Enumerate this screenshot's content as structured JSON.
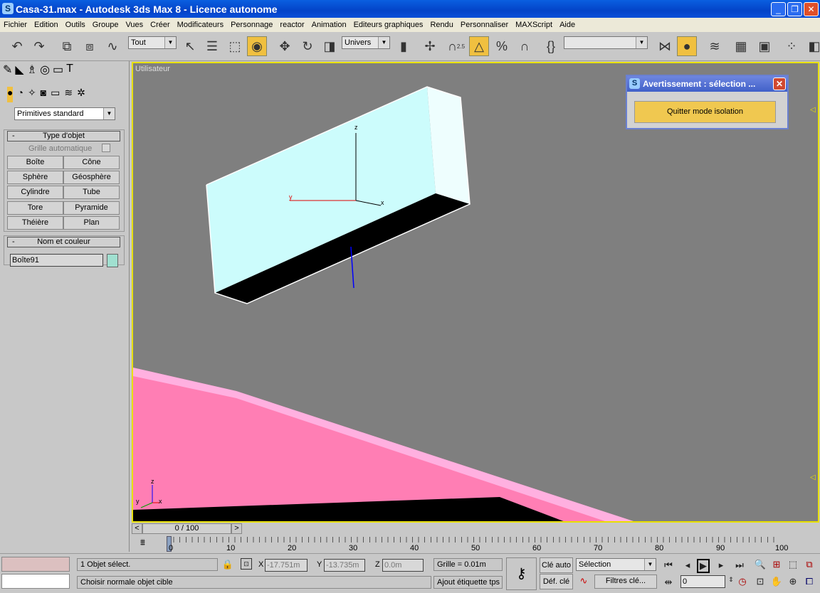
{
  "window": {
    "title": "Casa-31.max - Autodesk 3ds Max 8  - Licence autonome",
    "minimize": "_",
    "maximize": "❐",
    "close": "✕"
  },
  "menu": [
    "Fichier",
    "Edition",
    "Outils",
    "Groupe",
    "Vues",
    "Créer",
    "Modificateurs",
    "Personnage",
    "reactor",
    "Animation",
    "Editeurs graphiques",
    "Rendu",
    "Personnaliser",
    "MAXScript",
    "Aide"
  ],
  "toolbar": {
    "selection_filter": "Tout",
    "coord_system": "Univers",
    "snap_label": "2.5",
    "named_selection": ""
  },
  "command_panel": {
    "category_dropdown": "Primitives standard",
    "object_type": {
      "title": "Type d'objet",
      "auto_grid": "Grille automatique",
      "buttons": [
        "Boîte",
        "Cône",
        "Sphère",
        "Géosphère",
        "Cylindre",
        "Tube",
        "Tore",
        "Pyramide",
        "Théière",
        "Plan"
      ]
    },
    "name_color": {
      "title": "Nom et couleur",
      "name": "Boîte91",
      "color": "#a0e0d0"
    },
    "collapse": "-"
  },
  "viewport": {
    "label": "Utilisateur",
    "axis_x": "x",
    "axis_y": "y",
    "axis_z": "z",
    "border_color": "#e8e000",
    "background": "#7f7f7f"
  },
  "isolation_dialog": {
    "title": "Avertissement : sélection ...",
    "button": "Quitter mode isolation"
  },
  "time_slider": {
    "value": "0 / 100",
    "prev": "<",
    "next": ">"
  },
  "track": {
    "ticks": [
      "0",
      "10",
      "20",
      "30",
      "40",
      "50",
      "60",
      "70",
      "80",
      "90",
      "100"
    ]
  },
  "status": {
    "selected": "1 Objet sélect.",
    "prompt": "Choisir normale objet cible",
    "x_label": "X",
    "x": "-17.751m",
    "y_label": "Y",
    "y": "-13.735m",
    "z_label": "Z",
    "z": "0.0m",
    "grid": "Grille = 0.01m",
    "add_time_tag": "Ajout étiquette tps",
    "auto_key": "Clé auto",
    "set_key": "Déf. clé",
    "key_filter_select": "Sélection",
    "key_filters": "Filtres clé...",
    "frame": "0"
  }
}
